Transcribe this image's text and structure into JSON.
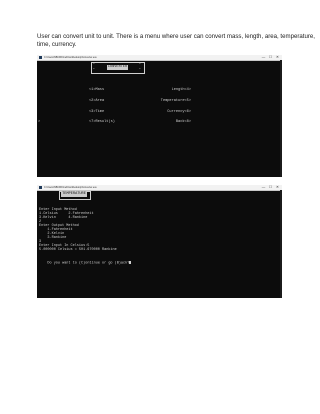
{
  "description": {
    "line1": "User can convert unit to unit. There is a menu where user can convert mass, length, area, temperature,",
    "line2": "time, currency."
  },
  "window1": {
    "title": "C:\\Users\\NBCM\\OneDrive\\Desktop\\Converter.exe",
    "controls": [
      "—",
      "☐",
      "✕"
    ],
    "box_title": "CONVERTER",
    "box_corner_marks": [
      "*",
      "*",
      "*",
      "*"
    ],
    "menu_left": [
      "<1>Mass",
      "<2>Area",
      "<3>Time",
      "<7>Result(s)"
    ],
    "menu_right": [
      "Length<4>",
      "Temperature<5>",
      "Currency<6>",
      "Back<8>"
    ],
    "prompt": ">"
  },
  "window2": {
    "title": "C:\\Users\\NBCM\\OneDrive\\Desktop\\Converter.exe",
    "controls": [
      "—",
      "☐",
      "✕"
    ],
    "box_title": "TEMPERATURE",
    "lines": [
      "Enter Input Method",
      "1.Celsius     2.Fahrenheit",
      "3.Kelvin      4.Rankine",
      "2",
      "Enter Output Method",
      "    1.Fahrenheit",
      "    2.Kelvin",
      "    3.Rankine",
      "3",
      "Enter Input In Celsius:5",
      "5.000000 Celsius = 501.670000 Rankine",
      "",
      "Do you want to (C)ontinue or go (B)ack?"
    ]
  }
}
